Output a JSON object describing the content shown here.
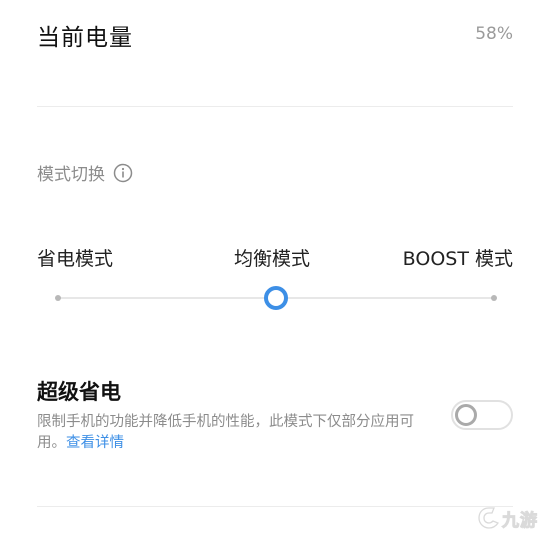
{
  "battery": {
    "label": "当前电量",
    "value": "58%"
  },
  "mode_switch": {
    "title": "模式切换",
    "info_icon": "info-icon",
    "modes": [
      "省电模式",
      "均衡模式",
      "BOOST 模式"
    ],
    "selected_index": 1,
    "slider_position_fraction": 0.5,
    "accent_color": "#3d8fe6"
  },
  "super_saver": {
    "title": "超级省电",
    "description": "限制手机的功能并降低手机的性能，此模式下仅部分应用可用。",
    "link": "查看详情",
    "enabled": false
  },
  "watermark": {
    "logo_icon": "jiuyou-logo-icon",
    "text": "九游"
  }
}
